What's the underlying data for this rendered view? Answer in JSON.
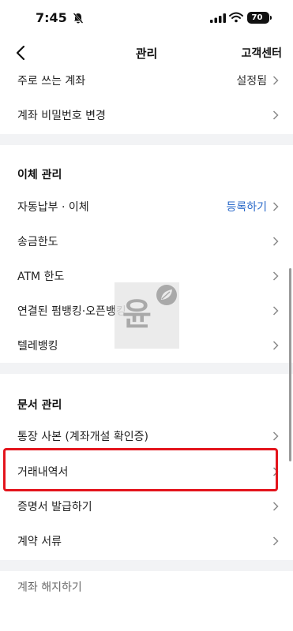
{
  "status_bar": {
    "time": "7:45",
    "battery": "70"
  },
  "header": {
    "title": "관리",
    "right_link": "고객센터"
  },
  "top_rows": [
    {
      "label": "주로 쓰는 계좌",
      "value": "설정됨"
    },
    {
      "label": "계좌 비밀번호 변경"
    }
  ],
  "transfer": {
    "title": "이체 관리",
    "rows": [
      {
        "label": "자동납부 · 이체",
        "value": "등록하기"
      },
      {
        "label": "송금한도"
      },
      {
        "label": "ATM 한도"
      },
      {
        "label": "연결된 펌뱅킹·오픈뱅킹"
      },
      {
        "label": "텔레뱅킹"
      }
    ]
  },
  "documents": {
    "title": "문서 관리",
    "rows": [
      {
        "label": "통장 사본 (계좌개설 확인증)"
      },
      {
        "label": "거래내역서"
      },
      {
        "label": "증명서 발급하기"
      },
      {
        "label": "계약 서류"
      }
    ]
  },
  "close_account": "계좌 해지하기",
  "watermark": {
    "text": "윤"
  },
  "colors": {
    "accent_blue": "#2a69c9",
    "highlight_red": "#e3141c",
    "band_gray": "#f2f3f5"
  }
}
